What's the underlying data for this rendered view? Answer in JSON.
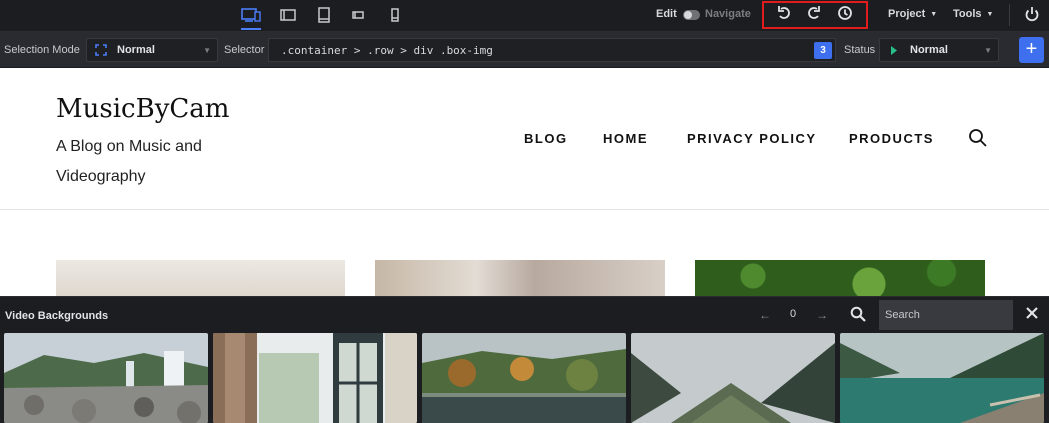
{
  "toolbar": {
    "devices": [
      {
        "name": "desktop",
        "active": true
      },
      {
        "name": "tablet-landscape",
        "active": false
      },
      {
        "name": "tablet-portrait",
        "active": false
      },
      {
        "name": "mobile-landscape",
        "active": false
      },
      {
        "name": "mobile-portrait",
        "active": false
      }
    ],
    "edit_label": "Edit",
    "navigate_label": "Navigate",
    "history_buttons": [
      "undo-icon",
      "redo-icon",
      "history-clock-icon"
    ],
    "project_label": "Project",
    "tools_label": "Tools",
    "highlight_color": "#e01c1c",
    "accent_color": "#3d6fee"
  },
  "selection_bar": {
    "selection_mode_label": "Selection Mode",
    "selection_mode_value": "Normal",
    "selector_label": "Selector",
    "selector_value": ".container > .row > div .box-img",
    "match_count": "3",
    "status_label": "Status",
    "status_value": "Normal",
    "add_label": "+"
  },
  "site": {
    "logo": "MusicByCam",
    "tagline": "A Blog on Music and Videography",
    "nav": [
      "BLOG",
      "HOME",
      "PRIVACY POLICY",
      "PRODUCTS"
    ]
  },
  "panel": {
    "title": "Video Backgrounds",
    "prev": "←",
    "page": "0",
    "next": "→",
    "search_placeholder": "Search",
    "videos": [
      "waterfall-beach",
      "window-curtains",
      "autumn-lake",
      "mountain-valley",
      "mountain-lake"
    ]
  }
}
